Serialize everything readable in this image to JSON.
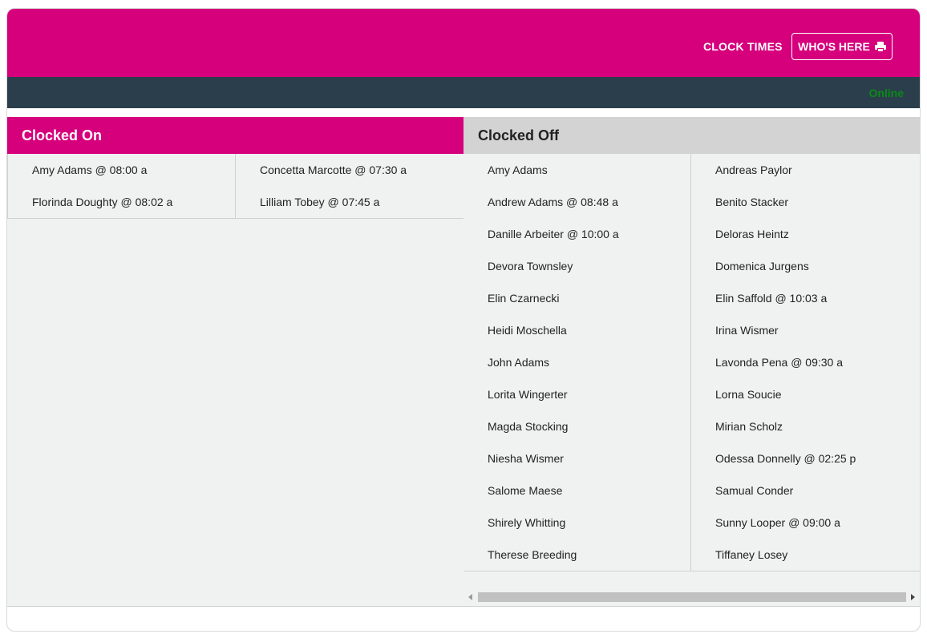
{
  "header": {
    "clock_times_label": "CLOCK TIMES",
    "whos_here_label": "WHO'S HERE",
    "brand_color": "#d6007d"
  },
  "status": {
    "text": "Online",
    "color": "#0a8a17"
  },
  "clocked_on": {
    "title": "Clocked On",
    "people": [
      "Amy Adams @ 08:00 a",
      "Concetta Marcotte @ 07:30 a",
      "Florinda Doughty @ 08:02 a",
      "Lilliam Tobey @ 07:45 a"
    ]
  },
  "clocked_off": {
    "title": "Clocked Off",
    "people": [
      "Amy Adams",
      "Andreas Paylor",
      "Andrew Adams @ 08:48 a",
      "Benito Stacker",
      "Danille Arbeiter @ 10:00 a",
      "Deloras Heintz",
      "Devora Townsley",
      "Domenica Jurgens",
      "Elin Czarnecki",
      "Elin Saffold @ 10:03 a",
      "Heidi Moschella",
      "Irina Wismer",
      "John Adams",
      "Lavonda Pena @ 09:30 a",
      "Lorita Wingerter",
      "Lorna Soucie",
      "Magda Stocking",
      "Mirian Scholz",
      "Niesha Wismer",
      "Odessa Donnelly @ 02:25 p",
      "Salome Maese",
      "Samual Conder",
      "Shirely Whitting",
      "Sunny Looper @ 09:00 a",
      "Therese Breeding",
      "Tiffaney Losey"
    ]
  }
}
